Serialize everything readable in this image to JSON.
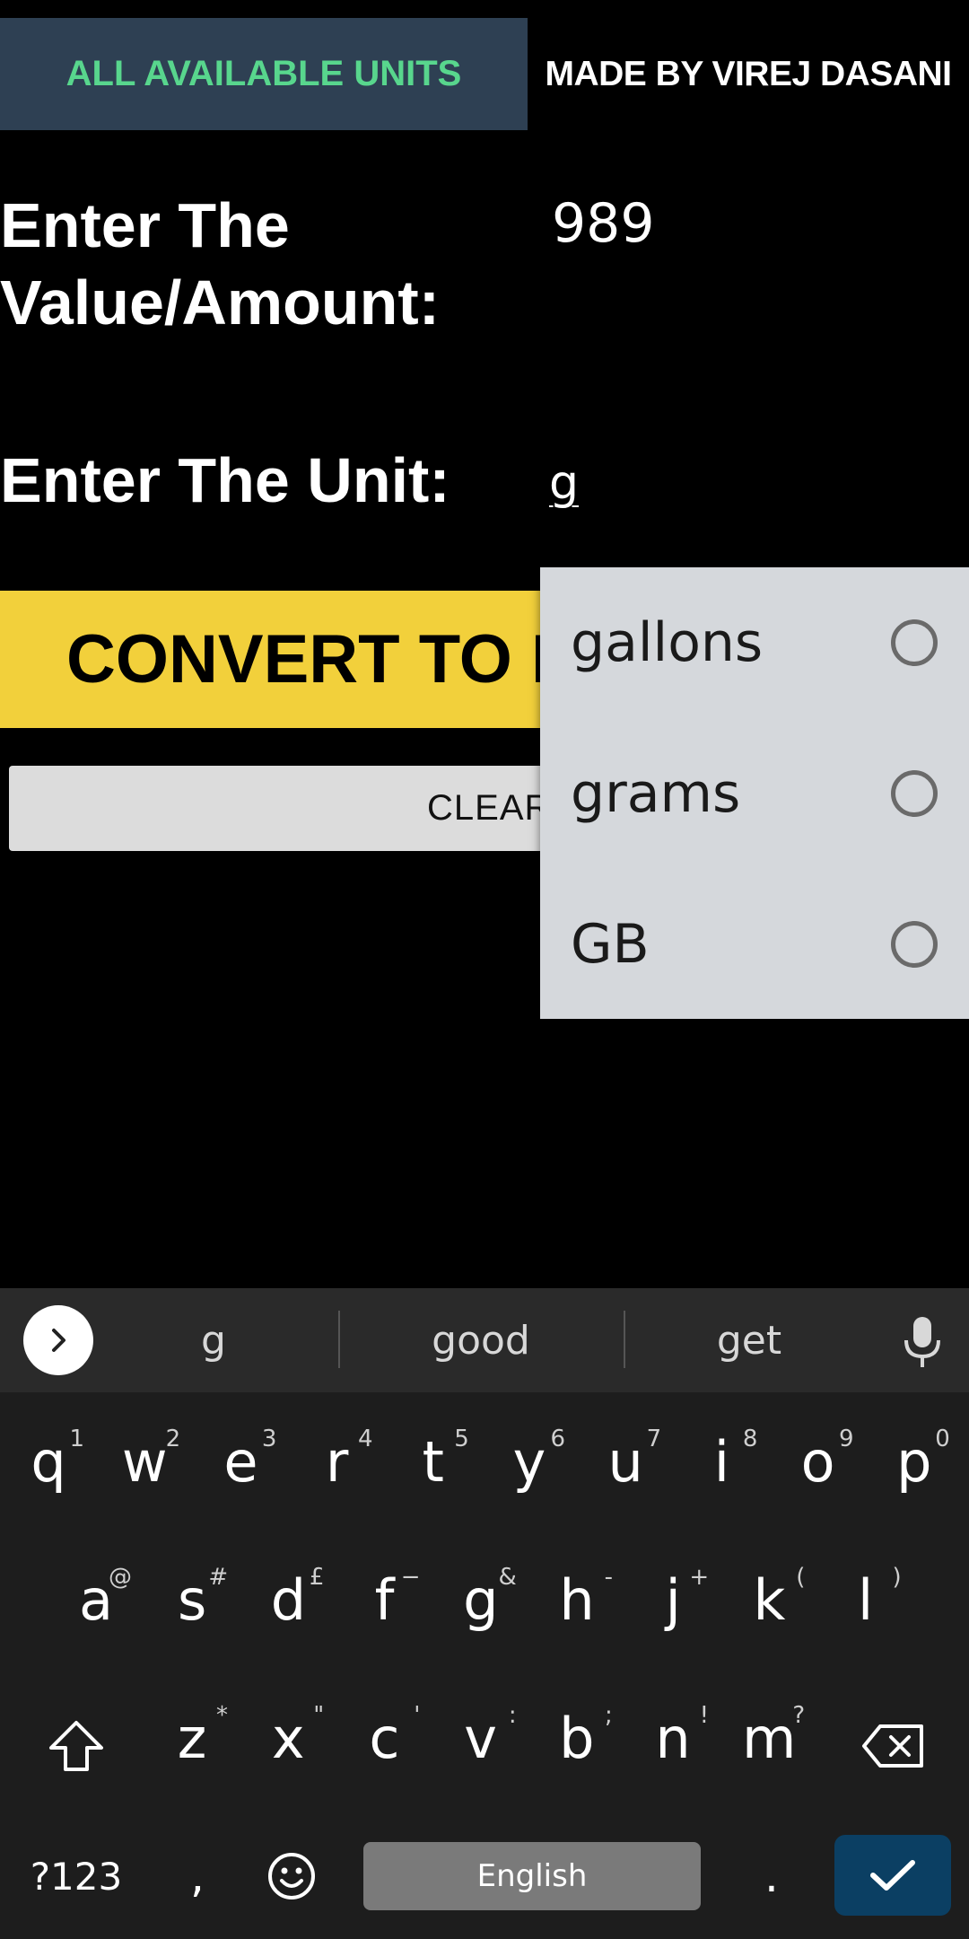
{
  "header": {
    "units_button": "ALL AVAILABLE UNITS",
    "credit": "MADE BY VIREJ DASANI"
  },
  "form": {
    "value_label": "Enter The Value/Amount:",
    "value_label_line1": "Enter The",
    "value_label_line2": "Value/Amount:",
    "value_input": "989",
    "unit_label": "Enter The Unit:",
    "unit_input": "g"
  },
  "actions": {
    "convert_label": "CONVERT TO EV",
    "clear_label": "CLEAR"
  },
  "dropdown": {
    "options": [
      {
        "label": "gallons",
        "selected": false
      },
      {
        "label": "grams",
        "selected": false
      },
      {
        "label": "GB",
        "selected": false
      }
    ]
  },
  "keyboard": {
    "suggestions": [
      "g",
      "good",
      "get"
    ],
    "row1": [
      {
        "k": "q",
        "h": "1"
      },
      {
        "k": "w",
        "h": "2"
      },
      {
        "k": "e",
        "h": "3"
      },
      {
        "k": "r",
        "h": "4"
      },
      {
        "k": "t",
        "h": "5"
      },
      {
        "k": "y",
        "h": "6"
      },
      {
        "k": "u",
        "h": "7"
      },
      {
        "k": "i",
        "h": "8"
      },
      {
        "k": "o",
        "h": "9"
      },
      {
        "k": "p",
        "h": "0"
      }
    ],
    "row2": [
      {
        "k": "a",
        "h": "@"
      },
      {
        "k": "s",
        "h": "#"
      },
      {
        "k": "d",
        "h": "£"
      },
      {
        "k": "f",
        "h": "−"
      },
      {
        "k": "g",
        "h": "&"
      },
      {
        "k": "h",
        "h": "-"
      },
      {
        "k": "j",
        "h": "+"
      },
      {
        "k": "k",
        "h": "("
      },
      {
        "k": "l",
        "h": ")"
      }
    ],
    "row3": [
      {
        "k": "z",
        "h": "*"
      },
      {
        "k": "x",
        "h": "\""
      },
      {
        "k": "c",
        "h": "'"
      },
      {
        "k": "v",
        "h": ":"
      },
      {
        "k": "b",
        "h": ";"
      },
      {
        "k": "n",
        "h": "!"
      },
      {
        "k": "m",
        "h": "?"
      }
    ],
    "symbols_key": "?123",
    "comma_key": ",",
    "space_label": "English",
    "period_key": ".",
    "icons": {
      "expand": "chevron-right-icon",
      "mic": "microphone-icon",
      "shift": "shift-icon",
      "backspace": "backspace-icon",
      "emoji": "emoji-icon",
      "enter": "checkmark-icon"
    }
  },
  "colors": {
    "header_bg": "#2e4053",
    "header_text": "#58d68d",
    "convert_bg": "#f2d03b",
    "dropdown_bg": "#d5d8dc",
    "enter_key_bg": "#0b3f63"
  }
}
